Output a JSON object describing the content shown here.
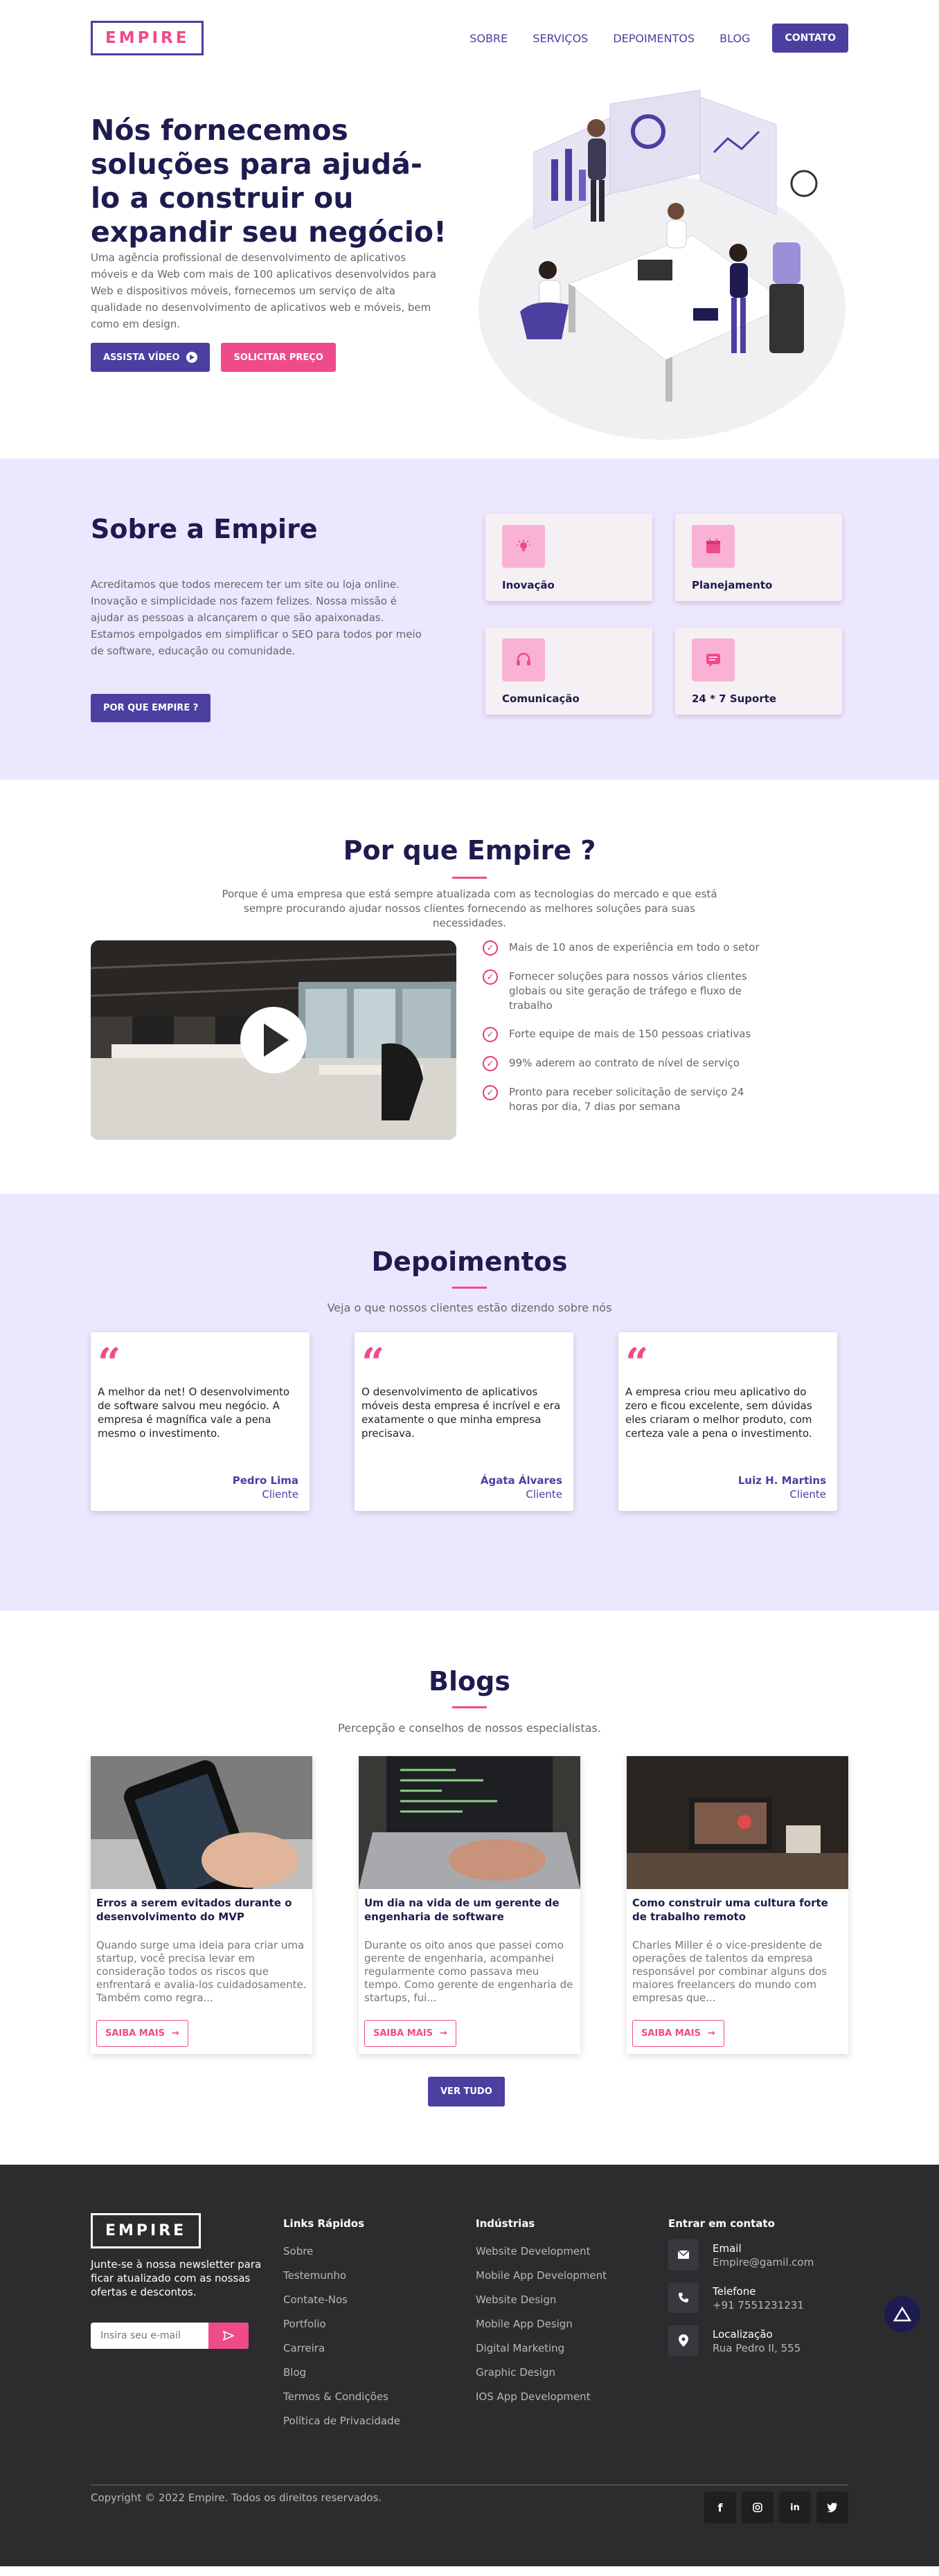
{
  "brand": {
    "name": "EMPIRE",
    "accent": "#4b3fa0",
    "pink": "#ef4b8b",
    "navy": "#1d1b4f"
  },
  "nav": {
    "items": [
      "SOBRE",
      "SERVIÇOS",
      "DEPOIMENTOS",
      "BLOG"
    ],
    "cta": "CONTATO"
  },
  "hero": {
    "title": "Nós fornecemos soluções para ajudá-lo a construir ou expandir seu negócio!",
    "text": "Uma agência profissional de desenvolvimento de aplicativos móveis e da Web com mais de 100 aplicativos desenvolvidos para Web e dispositivos móveis, fornecemos um serviço de alta qualidade no desenvolvimento de aplicativos web e móveis, bem como em design.",
    "btn_video": "ASSISTA VÍDEO",
    "btn_quote": "SOLICITAR PREÇO"
  },
  "about": {
    "title": "Sobre a Empire",
    "text": "Acreditamos que todos merecem ter um site ou loja online. Inovação e simplicidade nos fazem felizes. Nossa missão é ajudar as pessoas a alcançarem o que são apaixonadas. Estamos empolgados em simplificar o SEO para todos por meio de software, educação ou comunidade.",
    "button": "POR QUE EMPIRE ?",
    "features": [
      {
        "label": "Inovação",
        "icon": "lightbulb-icon"
      },
      {
        "label": "Planejamento",
        "icon": "calendar-icon"
      },
      {
        "label": "Comunicação",
        "icon": "headset-icon"
      },
      {
        "label": "24 * 7 Suporte",
        "icon": "chat-icon"
      }
    ]
  },
  "why": {
    "title": "Por que Empire ?",
    "subtitle": "Porque é uma empresa que está sempre atualizada com as tecnologias do mercado e que está sempre procurando ajudar nossos clientes fornecendo as melhores soluções para suas necessidades.",
    "points": [
      "Mais de 10 anos de experiência em todo o setor",
      "Fornecer soluções para nossos vários clientes globais ou site geração de tráfego e fluxo de trabalho",
      "Forte equipe de mais de 150 pessoas criativas",
      "99% aderem ao contrato de nível de serviço",
      "Pronto para receber solicitação de serviço 24 horas por dia, 7 dias por semana"
    ]
  },
  "testimonials": {
    "title": "Depoimentos",
    "subtitle": "Veja o que nossos clientes estão dizendo sobre nós",
    "items": [
      {
        "text": "A melhor da net! O desenvolvimento de software salvou meu negócio. A empresa é magnífica vale a pena mesmo o investimento.",
        "name": "Pedro Lima",
        "role": "Cliente"
      },
      {
        "text": "O desenvolvimento de aplicativos móveis desta empresa é incrível e era exatamente o que minha empresa precisava.",
        "name": "Ágata Álvares",
        "role": "Cliente"
      },
      {
        "text": "A empresa criou meu aplicativo do zero e ficou excelente, sem dúvidas eles criaram o melhor produto, com certeza vale a pena o investimento.",
        "name": "Luiz H. Martins",
        "role": "Cliente"
      }
    ]
  },
  "blogs": {
    "title": "Blogs",
    "subtitle": "Percepção e conselhos de nossos especialistas.",
    "more_label": "SAIBA MAIS",
    "all_label": "VER TUDO",
    "posts": [
      {
        "title": "Erros a serem evitados durante o desenvolvimento do MVP",
        "text": "Quando surge uma ideia para criar uma startup, você precisa levar em consideração todos os riscos que enfrentará e avalia-los cuidadosamente. Também como regra..."
      },
      {
        "title": "Um dia na vida de um gerente de engenharia de software",
        "text": "Durante os oito anos que passei como gerente de engenharia, acompanhei regularmente como passava meu tempo. Como gerente de engenharia de startups, fui..."
      },
      {
        "title": "Como construir uma cultura forte de trabalho remoto",
        "text": "Charles Miller é o vice-presidente de operações de talentos da empresa responsável por combinar alguns dos maiores freelancers do mundo com empresas que..."
      }
    ]
  },
  "footer": {
    "newsletter": "Junte-se à nossa newsletter para ficar atualizado com as nossas ofertas e descontos.",
    "email_placeholder": "Insira seu e-mail",
    "links_title": "Links Rápidos",
    "links": [
      "Sobre",
      "Testemunho",
      "Contate-Nos",
      "Portfolio",
      "Carreira",
      "Blog",
      "Termos & Condições",
      "Política de Privacidade"
    ],
    "industries_title": "Indústrias",
    "industries": [
      "Website Development",
      "Mobile App Development",
      "Website Design",
      "Mobile App Design",
      "Digital Marketing",
      "Graphic Design",
      "IOS App Development"
    ],
    "contact_title": "Entrar em contato",
    "contacts": [
      {
        "label": "Email",
        "value": "Empire@gamil.com",
        "icon": "mail-icon"
      },
      {
        "label": "Telefone",
        "value": "+91 7551231231",
        "icon": "phone-icon"
      },
      {
        "label": "Localização",
        "value": "Rua Pedro II, 555",
        "icon": "location-icon"
      }
    ],
    "copyright": "Copyright © 2022 Empire. Todos os direitos reservados.",
    "socials": [
      "facebook-icon",
      "instagram-icon",
      "linkedin-icon",
      "twitter-icon"
    ]
  }
}
